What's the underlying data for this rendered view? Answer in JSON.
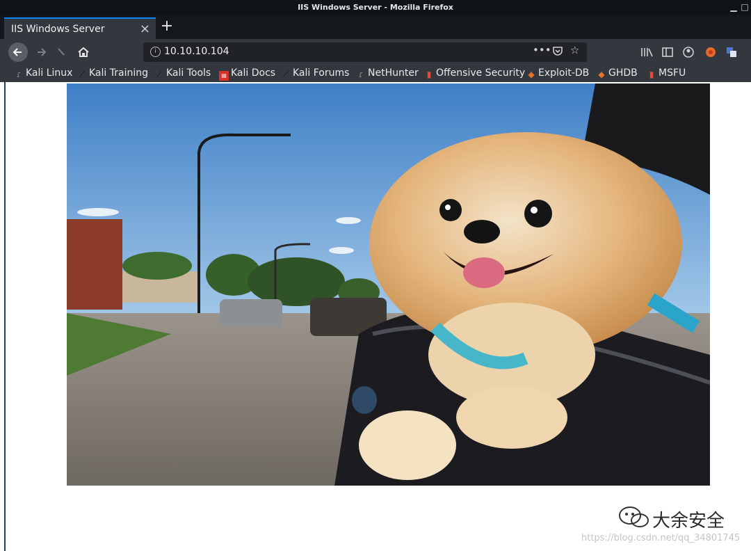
{
  "window": {
    "title": "IIS Windows Server - Mozilla Firefox"
  },
  "tab": {
    "label": "IIS Windows Server",
    "close": "×"
  },
  "new_tab": "+",
  "nav": {
    "url": "10.10.10.104",
    "page_actions": "•••"
  },
  "bookmarks": [
    {
      "label": "Kali Linux",
      "icon": "kali-dragon-icon"
    },
    {
      "label": "Kali Training",
      "icon": "kali-dragon-icon"
    },
    {
      "label": "Kali Tools",
      "icon": "kali-dragon-icon"
    },
    {
      "label": "Kali Docs",
      "icon": "kali-docs-icon"
    },
    {
      "label": "Kali Forums",
      "icon": "kali-dragon-icon"
    },
    {
      "label": "NetHunter",
      "icon": "kali-dragon-icon"
    },
    {
      "label": "Offensive Security",
      "icon": "offsec-icon"
    },
    {
      "label": "Exploit-DB",
      "icon": "exploitdb-icon"
    },
    {
      "label": "GHDB",
      "icon": "exploitdb-icon"
    },
    {
      "label": "MSFU",
      "icon": "offsec-icon"
    }
  ],
  "colors": {
    "accent": "#0a84ff",
    "toolbar": "#33383e",
    "titlebar": "#0f1419"
  },
  "watermark": {
    "name": "大余安全",
    "url": "https://blog.csdn.net/qq_34801745"
  }
}
